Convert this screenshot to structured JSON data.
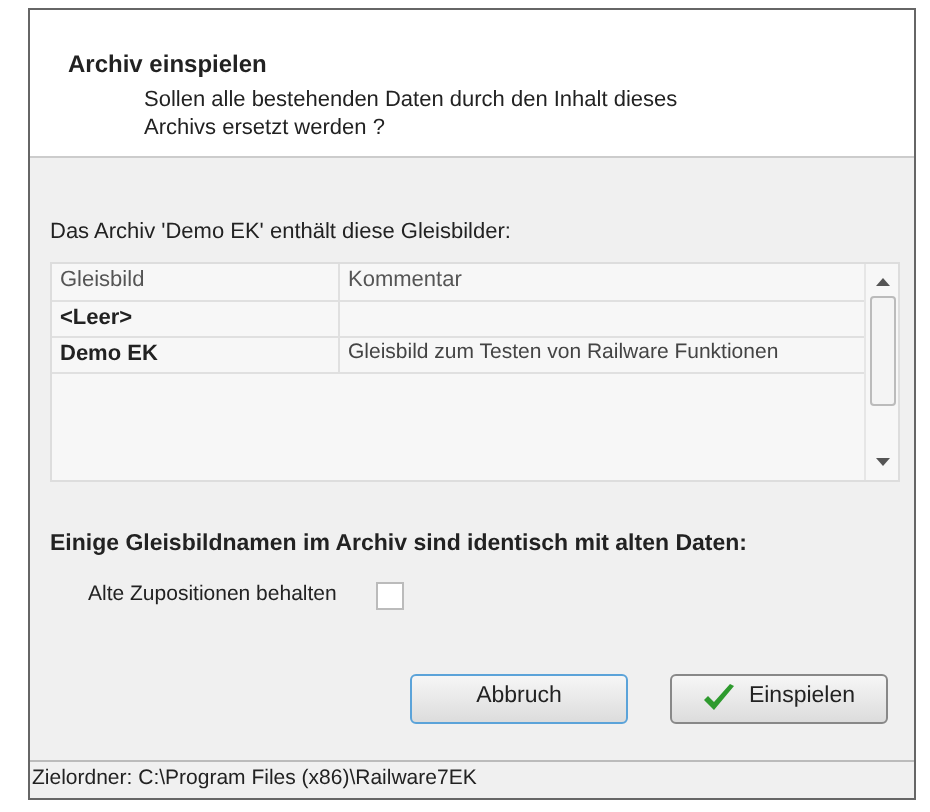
{
  "header": {
    "title": "Archiv einspielen",
    "message": "Sollen alle bestehenden Daten durch den Inhalt dieses Archivs ersetzt werden ?"
  },
  "intro": "Das Archiv 'Demo EK' enthält diese Gleisbilder:",
  "table": {
    "columns": [
      "Gleisbild",
      "Kommentar"
    ],
    "rows": [
      {
        "cells": [
          "<Leer>",
          ""
        ]
      },
      {
        "cells": [
          "Demo EK",
          "Gleisbild zum Testen von Railware Funktionen"
        ]
      }
    ]
  },
  "warning": "Einige Gleisbildnamen im Archiv sind identisch mit alten Daten:",
  "option": {
    "label": "Alte Zupositionen behalten",
    "checked": false
  },
  "buttons": [
    {
      "label": "Abbruch",
      "kind": "plain"
    },
    {
      "label": "Einspielen",
      "kind": "confirm"
    }
  ],
  "status_bar": "Zielordner: C:\\Program Files (x86)\\Railware7EK"
}
